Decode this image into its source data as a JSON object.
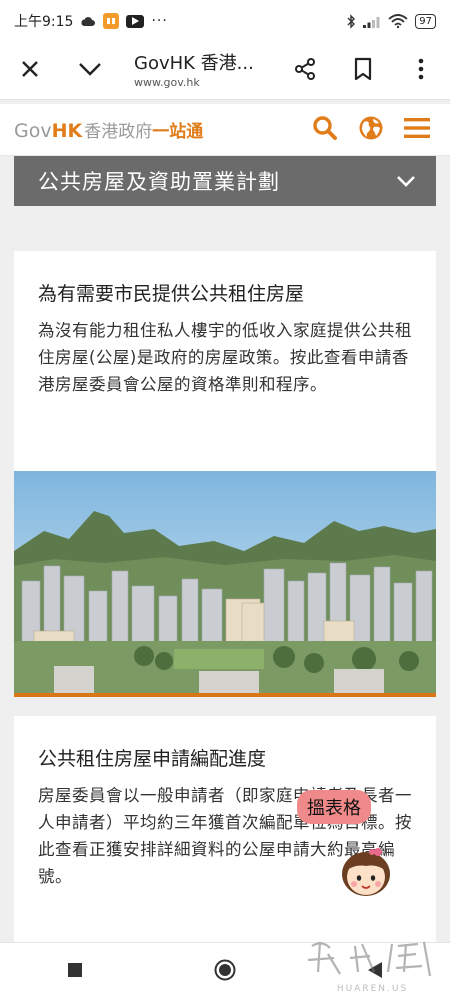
{
  "status_bar": {
    "time": "上午9:15",
    "battery": "97",
    "cloud_icon": "cloud-icon",
    "miui_icon": "app-notification-icon",
    "youtube_icon": "youtube-icon",
    "more_dots": "···"
  },
  "browser": {
    "title": "GovHK 香港...",
    "url": "www.gov.hk",
    "icons": [
      "close-icon",
      "chevron-down-icon",
      "share-icon",
      "bookmark-icon",
      "more-vert-icon"
    ]
  },
  "site": {
    "logo_gov": "Gov",
    "logo_hk": "HK",
    "logo_zh_grey": "香港政府",
    "logo_zh_orange": "一站通",
    "icons": [
      "search-icon",
      "globe-icon",
      "menu-icon"
    ],
    "accent_color": "#e07d1a"
  },
  "section": {
    "title": "公共房屋及資助置業計劃"
  },
  "cards": [
    {
      "title": "為有需要市民提供公共租住房屋",
      "text": "為沒有能力租住私人樓宇的低收入家庭提供公共租住房屋(公屋)是政府的房屋政策。按此查看申請香港房屋委員會公屋的資格準則和程序。"
    },
    {
      "title": "公共租住房屋申請編配進度",
      "text": "房屋委員會以一般申請者（即家庭申請者及長者一人申請者）平均約三年獲首次編配單位為目標。按此查看正獲安排詳細資料的公屋申請大約最高編號。"
    }
  ],
  "float_widget": {
    "label": "搵表格"
  },
  "nav": {
    "icons": [
      "recents-icon",
      "home-icon",
      "back-icon"
    ]
  },
  "watermark": {
    "text": "HUAREN.US"
  }
}
